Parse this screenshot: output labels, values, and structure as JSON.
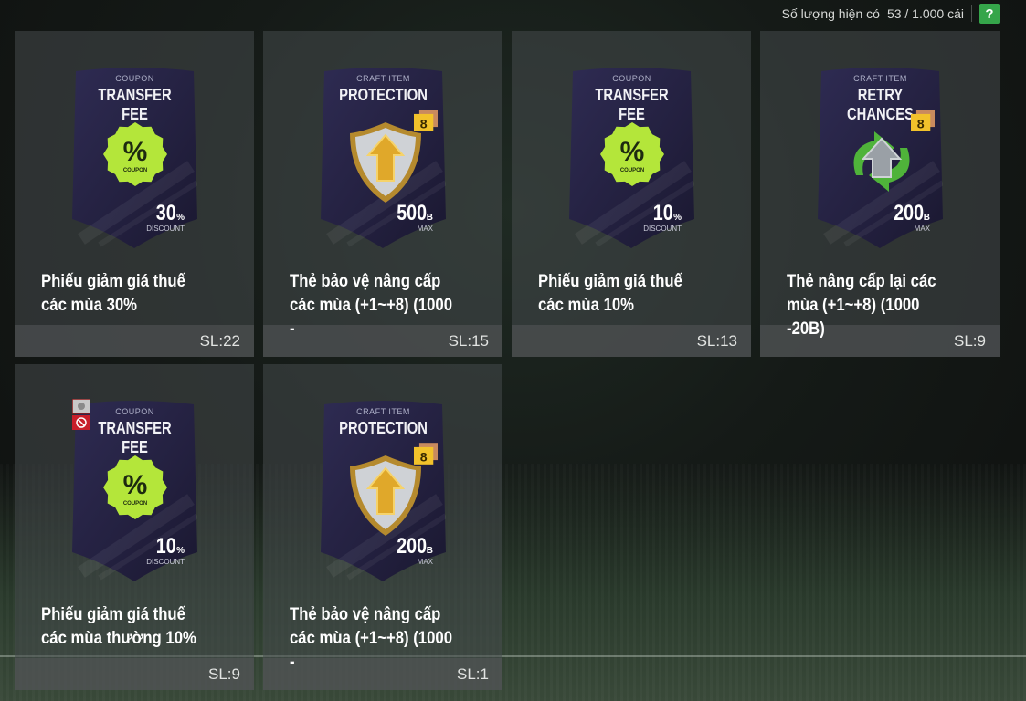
{
  "topbar": {
    "label": "Số lượng hiện có",
    "count": "53 / 1.000 cái",
    "help": "?"
  },
  "items": [
    {
      "category": "COUPON",
      "title": "TRANSFER FEE",
      "icon": "coupon-percent-icon",
      "value": "30",
      "unit": "%",
      "sub": "DISCOUNT",
      "name": "Phiếu giảm giá thuế các mùa 30%",
      "qty": "SL:22",
      "coupon_text": "COUPON"
    },
    {
      "category": "CRAFT ITEM",
      "title": "PROTECTION",
      "icon": "shield-arrow-icon",
      "value": "500",
      "unit": "B",
      "sub": "MAX",
      "name": "Thẻ bảo vệ nâng cấp các mùa (+1~+8) (1000 -",
      "qty": "SL:15",
      "level": "8"
    },
    {
      "category": "COUPON",
      "title": "TRANSFER FEE",
      "icon": "coupon-percent-icon",
      "value": "10",
      "unit": "%",
      "sub": "DISCOUNT",
      "name": "Phiếu giảm giá thuế các mùa 10%",
      "qty": "SL:13",
      "coupon_text": "COUPON"
    },
    {
      "category": "CRAFT ITEM",
      "title": "RETRY CHANCES",
      "icon": "retry-arrows-icon",
      "value": "200",
      "unit": "B",
      "sub": "MAX",
      "name": "Thẻ nâng cấp lại các mùa (+1~+8) (1000 -20B)",
      "qty": "SL:9",
      "level": "8"
    },
    {
      "category": "COUPON",
      "title": "TRANSFER FEE",
      "icon": "coupon-percent-icon",
      "value": "10",
      "unit": "%",
      "sub": "DISCOUNT",
      "name": "Phiếu giảm giá thuế các mùa thường 10%",
      "qty": "SL:9",
      "coupon_text": "COUPON"
    },
    {
      "category": "CRAFT ITEM",
      "title": "PROTECTION",
      "icon": "shield-arrow-icon",
      "value": "200",
      "unit": "B",
      "sub": "MAX",
      "name": "Thẻ bảo vệ nâng cấp các mùa (+1~+8) (1000 -",
      "qty": "SL:1",
      "level": "8"
    }
  ],
  "colors": {
    "accent": "#35a54a",
    "coupon_green": "#b4e63a",
    "card_dark": "#272444"
  }
}
